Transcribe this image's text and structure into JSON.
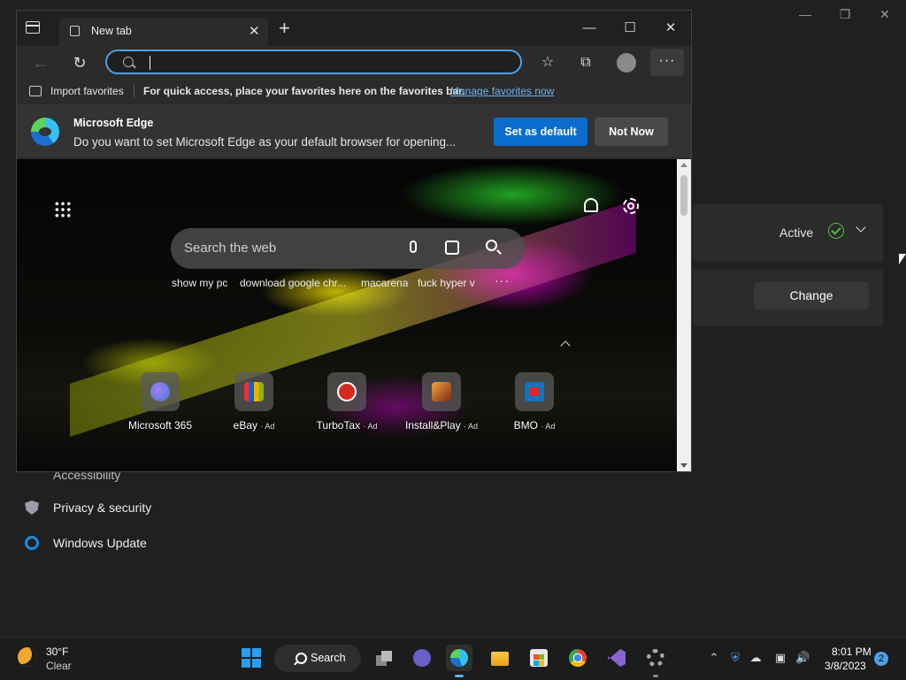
{
  "settings": {
    "active_label": "Active",
    "change_label": "Change",
    "sidebar": {
      "accessibility": "Accessibility",
      "privacy": "Privacy & security",
      "update": "Windows Update"
    }
  },
  "browser": {
    "tab_title": "New tab",
    "address_value": "",
    "favorites_bar": {
      "import_label": "Import favorites",
      "hint": "For quick access, place your favorites here on the favorites bar.",
      "manage_link": "Manage favorites now"
    },
    "banner": {
      "title": "Microsoft Edge",
      "text": "Do you want to set Microsoft Edge as your default browser for opening...",
      "primary_button": "Set as default",
      "secondary_button": "Not Now"
    },
    "ntp": {
      "search_placeholder": "Search the web",
      "suggestions": [
        "show my pc",
        "download google chr...",
        "macarena",
        "fuck hyper v"
      ],
      "more": "···",
      "tiles": [
        {
          "label": "Microsoft 365",
          "ad": "",
          "color": "#7a5cd6"
        },
        {
          "label": "eBay",
          "ad": "· Ad",
          "color": "#e53238"
        },
        {
          "label": "TurboTax",
          "ad": "· Ad",
          "color": "#d52b1e"
        },
        {
          "label": "Install&Play",
          "ad": "· Ad",
          "color": "#b5651d"
        },
        {
          "label": "BMO",
          "ad": "· Ad",
          "color": "#0079c1"
        }
      ]
    }
  },
  "taskbar": {
    "weather_temp": "30°F",
    "weather_condition": "Clear",
    "search_label": "Search",
    "time": "8:01 PM",
    "date": "3/8/2023",
    "notification_count": "2"
  }
}
